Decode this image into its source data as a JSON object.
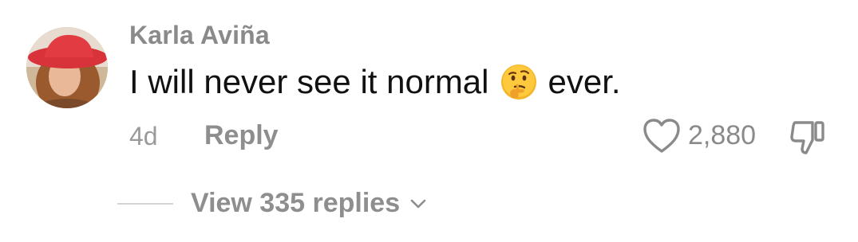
{
  "comment": {
    "author": "Karla Aviña",
    "text_before": "I will never see it normal",
    "emoji": "thinking-face-emoji",
    "text_after": "ever.",
    "time": "4d",
    "reply_label": "Reply",
    "like_count": "2,880",
    "view_replies_label": "View 335 replies"
  },
  "icons": {
    "like": "heart-outline-icon",
    "dislike": "thumbs-down-outline-icon",
    "expand": "chevron-down-icon"
  },
  "colors": {
    "author": "#8a8a8a",
    "text": "#111111",
    "muted": "#8e8e8e",
    "divider": "#d3d3d3",
    "background": "#ffffff"
  }
}
